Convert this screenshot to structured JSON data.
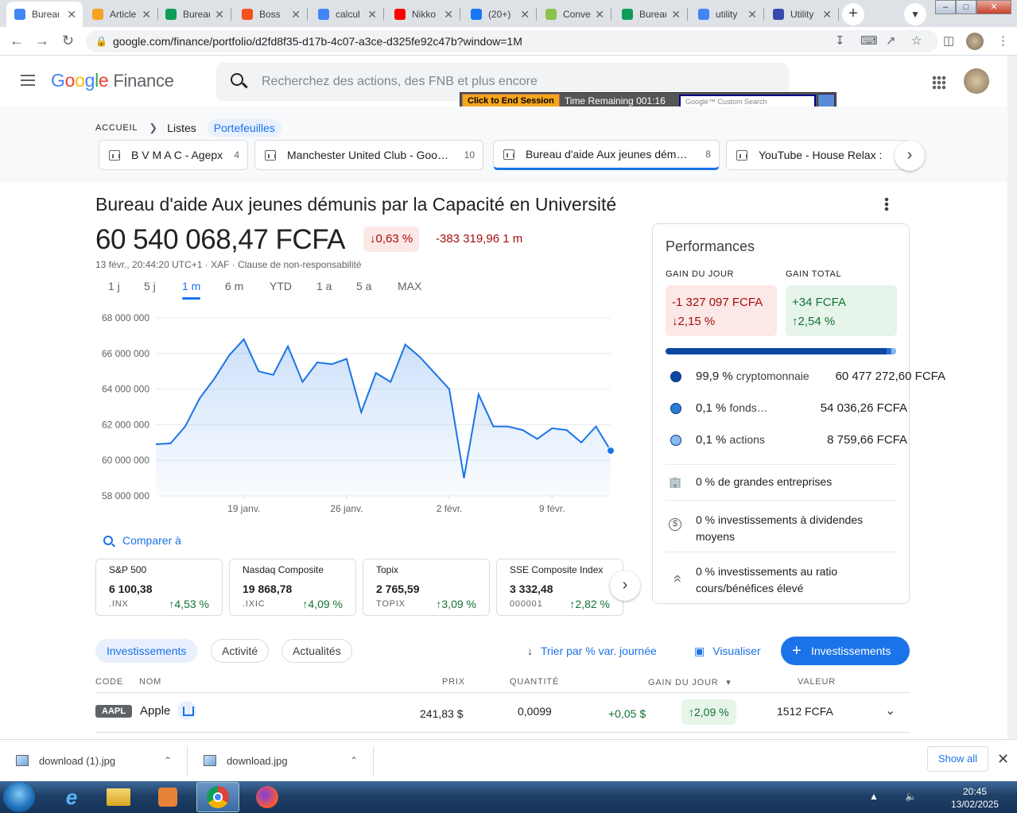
{
  "browser": {
    "tabs": [
      {
        "title": "Bureau d'aide",
        "fav": "#4285f4",
        "active": true
      },
      {
        "title": "Article",
        "fav": "#f4a322"
      },
      {
        "title": "Bureau",
        "fav": "#0f9d58"
      },
      {
        "title": "Boss",
        "fav": "#f4511e"
      },
      {
        "title": "calcul",
        "fav": "#4285f4"
      },
      {
        "title": "Nikko",
        "fav": "#ff0000"
      },
      {
        "title": "(20+)",
        "fav": "#1877f2"
      },
      {
        "title": "Conve",
        "fav": "#8bc34a"
      },
      {
        "title": "Bureau",
        "fav": "#0f9d58"
      },
      {
        "title": "utility",
        "fav": "#4285f4"
      },
      {
        "title": "Utility",
        "fav": "#3949ab"
      }
    ],
    "url": "google.com/finance/portfolio/d2fd8f35-d17b-4c07-a3ce-d325fe92c47b?window=1M"
  },
  "header": {
    "logo_google": "Google",
    "logo_finance": "Finance",
    "search_placeholder": "Recherchez des actions, des FNB et plus encore"
  },
  "overlay": {
    "end_session": "Click to End Session",
    "time_remaining": "Time Remaining 001:16",
    "custom_search": "Google™ Custom Search"
  },
  "breadcrumb": {
    "home": "ACCUEIL",
    "lists": "Listes",
    "portfolios": "Portefeuilles"
  },
  "portfolio_tabs": [
    {
      "name": "B V M A C - Agepx",
      "count": "4"
    },
    {
      "name": "Manchester United Club - Goo…",
      "count": "10"
    },
    {
      "name": "Bureau d'aide Aux jeunes dém…",
      "count": "8"
    },
    {
      "name": "YouTube - House Relax : h",
      "count": ""
    }
  ],
  "portfolio": {
    "title": "Bureau d'aide Aux jeunes démunis par la Capacité en Université",
    "value": "60 540 068,47 FCFA",
    "change_pct": "↓0,63 %",
    "change_abs": "-383 319,96 1 m",
    "date_line": "13 févr., 20:44:20 UTC+1 · XAF · Clause de non-responsabilité"
  },
  "ranges": [
    "1 j",
    "5 j",
    "1 m",
    "6 m",
    "YTD",
    "1 a",
    "5 a",
    "MAX"
  ],
  "selected_range": "1 m",
  "chart_data": {
    "type": "area",
    "x": [
      "2025-01-13",
      "2025-01-14",
      "2025-01-15",
      "2025-01-16",
      "2025-01-17",
      "2025-01-18",
      "2025-01-19",
      "2025-01-20",
      "2025-01-21",
      "2025-01-22",
      "2025-01-23",
      "2025-01-24",
      "2025-01-25",
      "2025-01-26",
      "2025-01-27",
      "2025-01-28",
      "2025-01-29",
      "2025-01-30",
      "2025-01-31",
      "2025-02-01",
      "2025-02-02",
      "2025-02-03",
      "2025-02-04",
      "2025-02-05",
      "2025-02-06",
      "2025-02-07",
      "2025-02-08",
      "2025-02-09",
      "2025-02-10",
      "2025-02-11",
      "2025-02-12",
      "2025-02-13"
    ],
    "y": [
      60900000,
      60950000,
      61900000,
      63500000,
      64600000,
      65900000,
      66800000,
      65000000,
      64800000,
      66400000,
      64400000,
      65500000,
      65400000,
      65700000,
      62700000,
      64900000,
      64400000,
      66500000,
      65800000,
      64900000,
      64000000,
      59000000,
      63700000,
      61900000,
      61900000,
      61700000,
      61200000,
      61800000,
      61700000,
      61000000,
      61900000,
      60540068
    ],
    "y_ticks": [
      "68 000 000",
      "66 000 000",
      "64 000 000",
      "62 000 000",
      "60 000 000",
      "58 000 000"
    ],
    "x_ticks": [
      "19 janv.",
      "26 janv.",
      "2 févr.",
      "9 févr."
    ],
    "ylim": [
      58000000,
      68000000
    ],
    "color": "#1a73e8"
  },
  "compare": {
    "label": "Comparer à"
  },
  "indices": [
    {
      "name": "S&P 500",
      "value": "6 100,38",
      "code": ".INX",
      "change": "↑4,53 %"
    },
    {
      "name": "Nasdaq Composite",
      "value": "19 868,78",
      "code": ".IXIC",
      "change": "↑4,09 %"
    },
    {
      "name": "Topix",
      "value": "2 765,59",
      "code": "TOPIX",
      "change": "↑3,09 %"
    },
    {
      "name": "SSE Composite Index",
      "value": "3 332,48",
      "code": "000001",
      "change": "↑2,82 %"
    }
  ],
  "performance": {
    "title": "Performances",
    "day_label": "GAIN DU JOUR",
    "total_label": "GAIN TOTAL",
    "day_value": "-1 327 097 FCFA",
    "day_pct": "↓2,15 %",
    "total_value": "+34 FCFA",
    "total_pct": "↑2,54 %",
    "allocation": [
      {
        "pct": "99,9 %",
        "label": "cryptomonnaie",
        "amount": "60 477 272,60 FCFA",
        "color": "#0d47a1"
      },
      {
        "pct": "0,1 %",
        "label": "fonds…",
        "amount": "54 036,26 FCFA",
        "color": "#2c7bd6"
      },
      {
        "pct": "0,1 %",
        "label": "actions",
        "amount": "8 759,66 FCFA",
        "color": "#89b9ef"
      }
    ],
    "facts": [
      {
        "pct": "0 %",
        "text": "de grandes entreprises",
        "icon": "building-icon"
      },
      {
        "pct": "0 %",
        "text": "investissements à dividendes moyens",
        "icon": "dollar-icon"
      },
      {
        "pct": "0 %",
        "text": "investissements au ratio cours/bénéfices élevé",
        "icon": "chevrons-up-icon"
      }
    ]
  },
  "investments": {
    "chips": [
      "Investissements",
      "Activité",
      "Actualités"
    ],
    "sort_label": "Trier par % var. journée",
    "visualize_label": "Visualiser",
    "add_label": "Investissements",
    "columns": [
      "CODE",
      "NOM",
      "PRIX",
      "QUANTITÉ",
      "GAIN DU JOUR",
      "VALEUR"
    ],
    "rows": [
      {
        "code": "AAPL",
        "name": "Apple",
        "price": "241,83 $",
        "qty": "0,0099",
        "day_gain": "+0,05 $",
        "day_pct": "↑2,09 %",
        "value": "1512 FCFA"
      }
    ]
  },
  "downloads": {
    "items": [
      "download (1).jpg",
      "download.jpg"
    ],
    "show_all": "Show all"
  },
  "taskbar": {
    "time": "20:45",
    "date": "13/02/2025"
  }
}
